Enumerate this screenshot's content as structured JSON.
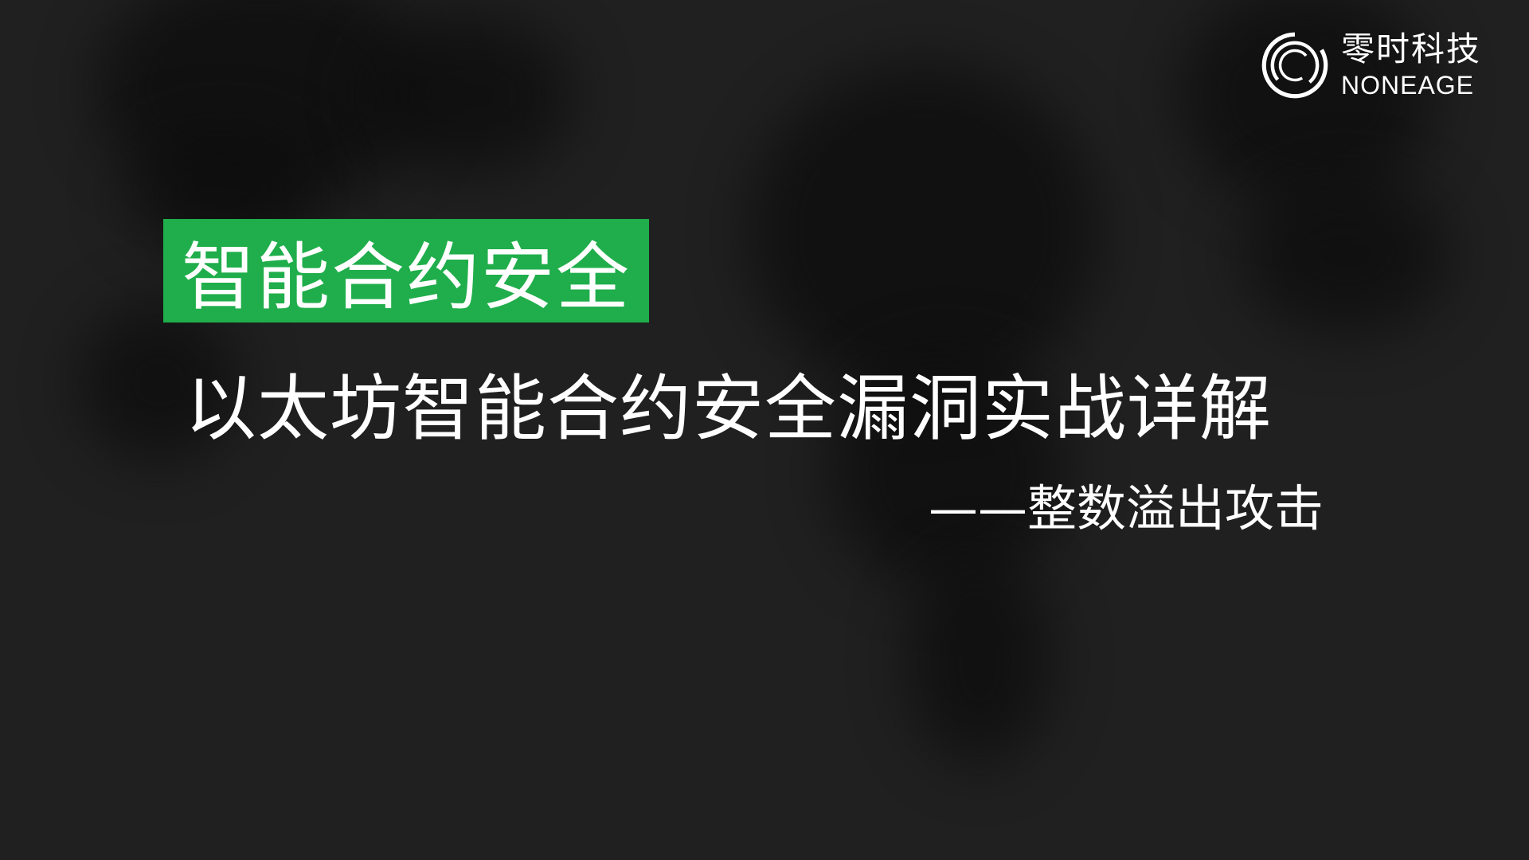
{
  "logo": {
    "name_cn": "零时科技",
    "name_en": "NONEAGE",
    "icon": "swirl-ring-logo-icon"
  },
  "tag": {
    "label": "智能合约安全",
    "color": "#1fae4b"
  },
  "title": "以太坊智能合约安全漏洞实战详解",
  "subtitle": "——整数溢出攻击",
  "colors": {
    "background": "#202020",
    "text": "#ffffff",
    "accent": "#1fae4b"
  }
}
